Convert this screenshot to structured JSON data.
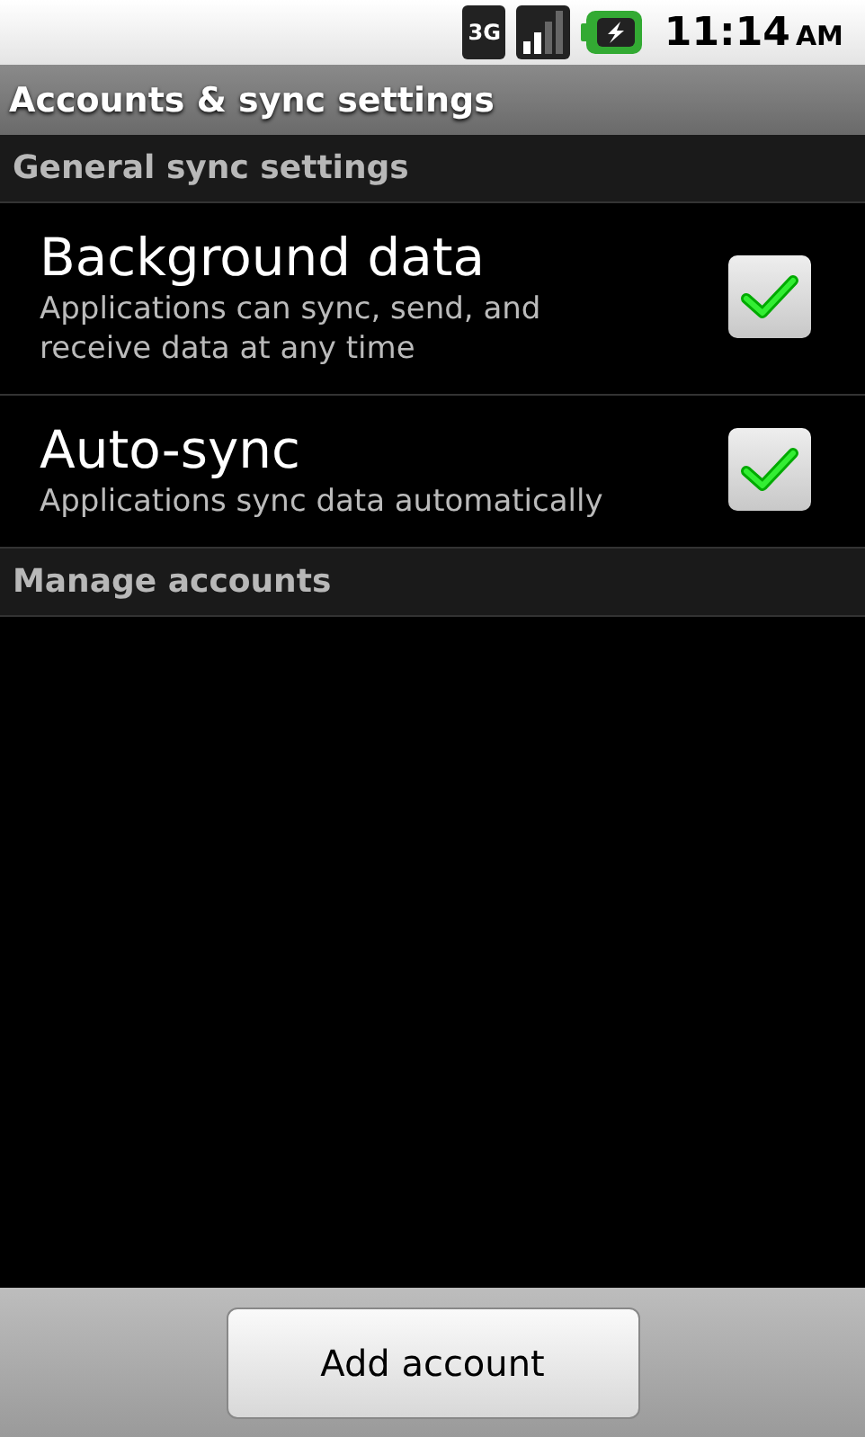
{
  "status_bar": {
    "network_label": "3G",
    "time": "11:14",
    "time_suffix": "AM"
  },
  "title": "Accounts & sync settings",
  "sections": [
    {
      "header": "General sync settings",
      "items": [
        {
          "kind": "checkbox",
          "title": "Background data",
          "summary": "Applications can sync, send, and receive data at any time",
          "checked": true
        },
        {
          "kind": "checkbox",
          "title": "Auto-sync",
          "summary": "Applications sync data automatically",
          "checked": true
        }
      ]
    },
    {
      "header": "Manage accounts"
    }
  ],
  "footer_button": "Add account"
}
